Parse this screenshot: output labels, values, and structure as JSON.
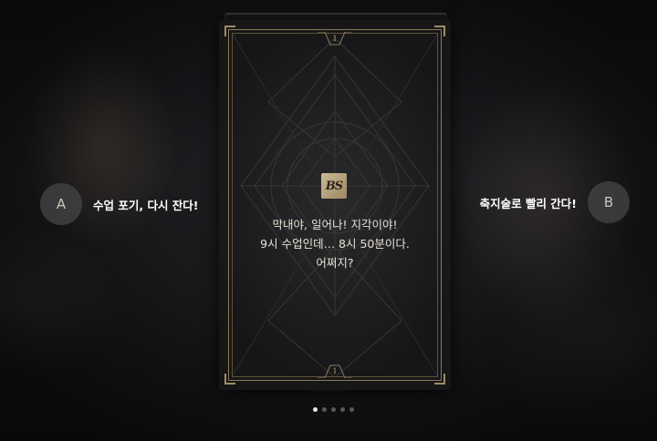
{
  "card": {
    "page_top": "1",
    "page_bottom": "1",
    "logo_text": "BS",
    "story_lines": [
      "막내야, 일어나! 지각이야!",
      "9시 수업인데… 8시 50분이다.",
      "어쩌지?"
    ]
  },
  "choices": {
    "a": {
      "key": "A",
      "label": "수업 포기, 다시 잔다!"
    },
    "b": {
      "key": "B",
      "label": "축지술로 빨리 간다!"
    }
  },
  "pagination": {
    "total": 5,
    "current": 1
  },
  "colors": {
    "gold": "#a08c66",
    "text": "#e8e2d6"
  }
}
